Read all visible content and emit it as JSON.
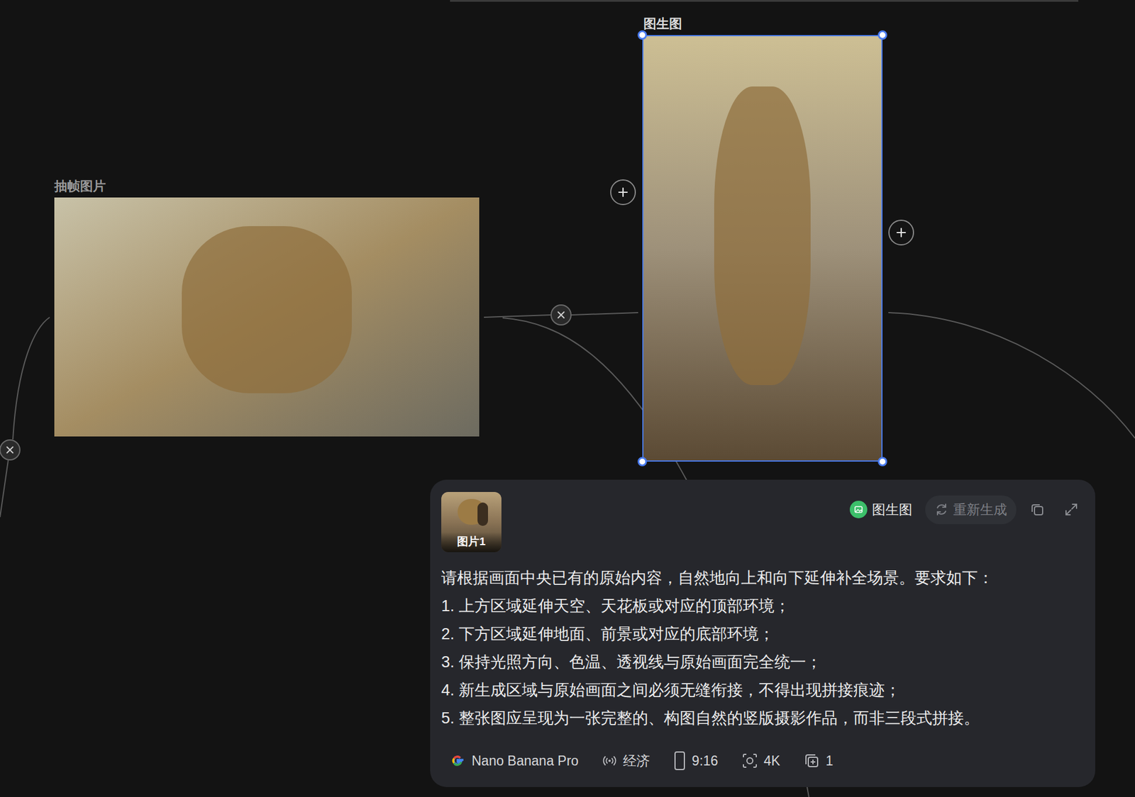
{
  "nodes": [
    {
      "label": "抽帧图片",
      "selected": false
    },
    {
      "label": "图生图",
      "selected": true
    }
  ],
  "prompt_panel": {
    "reference_label": "图片1",
    "mode": "图生图",
    "regenerate": {
      "label": "重新生成",
      "disabled": true
    },
    "prompt_lines": [
      "请根据画面中央已有的原始内容，自然地向上和向下延伸补全场景。要求如下：",
      "1. 上方区域延伸天空、天花板或对应的顶部环境；",
      "2. 下方区域延伸地面、前景或对应的底部环境；",
      "3. 保持光照方向、色温、透视线与原始画面完全统一；",
      "4. 新生成区域与原始画面之间必须无缝衔接，不得出现拼接痕迹；",
      "5. 整张图应呈现为一张完整的、构图自然的竖版摄影作品，而非三段式拼接。"
    ],
    "settings": [
      {
        "kind": "model",
        "label": "Nano Banana Pro"
      },
      {
        "kind": "speed",
        "label": "经济"
      },
      {
        "kind": "ratio",
        "label": "9:16"
      },
      {
        "kind": "resolution",
        "label": "4K"
      },
      {
        "kind": "count",
        "label": "1"
      }
    ]
  }
}
